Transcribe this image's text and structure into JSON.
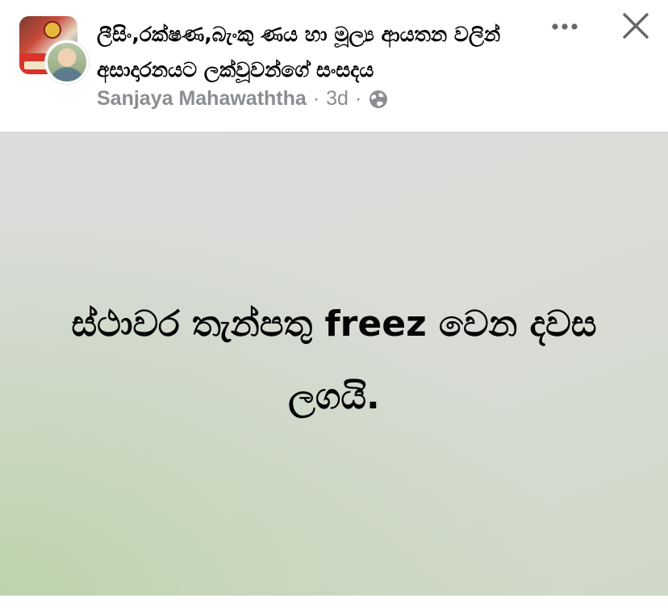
{
  "post": {
    "group_name_line1": "ලීසිං,රක්ෂණ,බැංකු ණය හා මූල්‍ය ආයතන වලින්",
    "group_name_line2": "අසාදාරනයට ලක්වූවන්ගේ  සංසදය",
    "author": "Sanjaya Mahawaththa",
    "separator": "·",
    "timestamp": "3d",
    "audience_icon": "globe-icon",
    "body_text": "ස්ථාවර තැන්පතු freez වෙන දවස ලගයි."
  },
  "actions": {
    "more_icon": "more-horizontal-icon",
    "close_icon": "close-icon"
  },
  "colors": {
    "text_primary": "#050505",
    "text_secondary": "#8a8d91",
    "background_gradient_start": "#dcdcdc",
    "background_gradient_accent": "#bcd3ad"
  }
}
